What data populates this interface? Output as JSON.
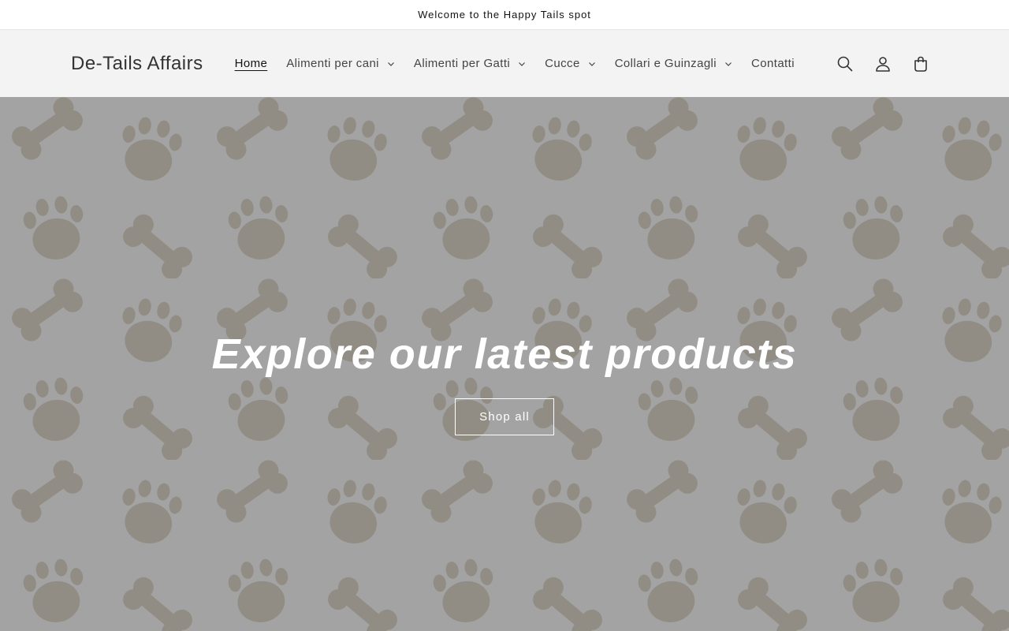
{
  "announcement": {
    "text": "Welcome to the Happy Tails spot"
  },
  "header": {
    "logo": "De-Tails Affairs",
    "nav": [
      {
        "label": "Home",
        "active": true,
        "dropdown": false
      },
      {
        "label": "Alimenti per cani",
        "active": false,
        "dropdown": true
      },
      {
        "label": "Alimenti per Gatti",
        "active": false,
        "dropdown": true
      },
      {
        "label": "Cucce",
        "active": false,
        "dropdown": true
      },
      {
        "label": "Collari e Guinzagli",
        "active": false,
        "dropdown": true
      },
      {
        "label": "Contatti",
        "active": false,
        "dropdown": false
      }
    ],
    "icons": [
      "search-icon",
      "account-icon",
      "cart-icon"
    ]
  },
  "hero": {
    "title": "Explore our latest products",
    "button": "Shop all",
    "background_pattern": "paw-and-bone-pattern"
  },
  "colors": {
    "header_bg": "#f3f3f3",
    "hero_bg": "#9d9d9d",
    "pattern_fill": "#8c8679",
    "text": "#121212"
  }
}
